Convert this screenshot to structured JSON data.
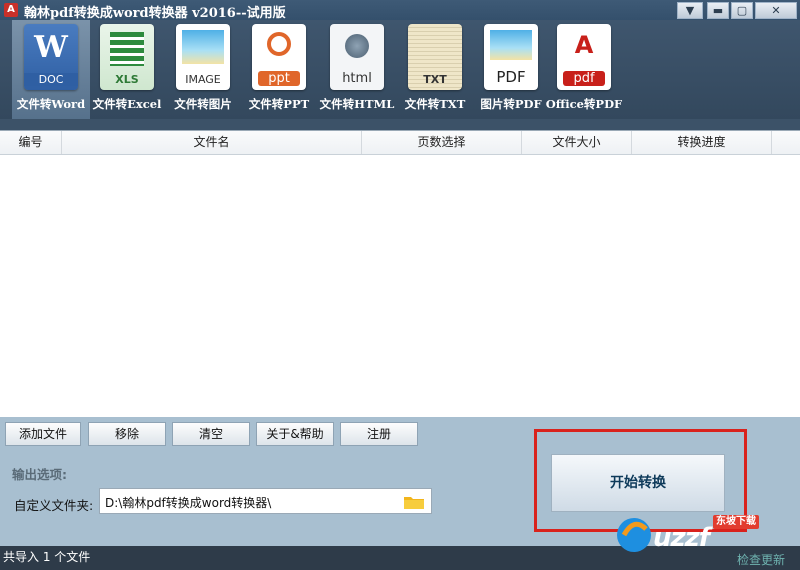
{
  "window": {
    "title": "翰林pdf转换成word转换器 v2016--试用版",
    "icons": {
      "app": "pdf-app-icon",
      "dropdown": "chevron-down-icon",
      "minimize": "minimize-icon",
      "maximize": "maximize-icon",
      "close": "close-icon"
    }
  },
  "toolbar": {
    "items": [
      {
        "label": "文件转Word",
        "icon": "word-doc-icon",
        "tag": "DOC"
      },
      {
        "label": "文件转Excel",
        "icon": "excel-xls-icon",
        "tag": "XLS"
      },
      {
        "label": "文件转图片",
        "icon": "image-icon",
        "tag": "IMAGE"
      },
      {
        "label": "文件转PPT",
        "icon": "ppt-icon",
        "tag": "ppt"
      },
      {
        "label": "文件转HTML",
        "icon": "html-icon",
        "tag": "html"
      },
      {
        "label": "文件转TXT",
        "icon": "txt-icon",
        "tag": "TXT"
      },
      {
        "label": "图片转PDF",
        "icon": "image-to-pdf-icon",
        "tag": "PDF"
      },
      {
        "label": "Office转PDF",
        "icon": "office-to-pdf-icon",
        "tag": "pdf"
      }
    ]
  },
  "table": {
    "headers": [
      "编号",
      "文件名",
      "页数选择",
      "文件大小",
      "转换进度"
    ],
    "rows": []
  },
  "actions": {
    "add_file": "添加文件",
    "remove": "移除",
    "clear": "清空",
    "about_help": "关于&帮助",
    "register": "注册"
  },
  "output": {
    "title": "输出选项:",
    "custom_folder_label": "自定义文件夹:",
    "path": "D:\\翰林pdf转换成word转换器\\",
    "folder_icon": "folder-icon"
  },
  "start_button": "开始转换",
  "status": {
    "text": "共导入 1 个文件",
    "check_update": "检查更新"
  },
  "watermark": {
    "text": "uzzf",
    "badge": "东坡下载"
  },
  "colors": {
    "highlight_frame": "#d9221c",
    "title_bar": "#34506c",
    "panel": "#a8bfd0"
  }
}
